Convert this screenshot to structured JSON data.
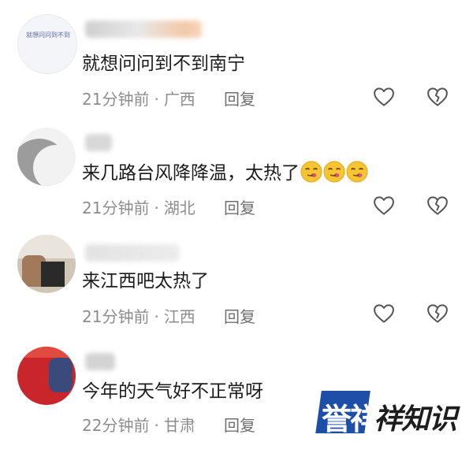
{
  "comments": [
    {
      "text": "就想问问到不到南宁",
      "time": "21分钟前",
      "location": "广西",
      "reply_label": "回复",
      "avatar_text": "就想问问到不到"
    },
    {
      "text": "来几路台风降降温，太热了",
      "time": "21分钟前",
      "location": "湖北",
      "reply_label": "回复"
    },
    {
      "text": "来江西吧太热了",
      "time": "21分钟前",
      "location": "江西",
      "reply_label": "回复"
    },
    {
      "text": "今年的天气好不正常呀",
      "time": "22分钟前",
      "location": "甘肃",
      "reply_label": "回复"
    }
  ],
  "separator": "·",
  "watermark": {
    "box_text": "誉祥",
    "text": "祥知识"
  },
  "icons": {
    "like": "heart-outline-icon",
    "dislike": "broken-heart-icon",
    "emoji": "smirk-emoji-icon"
  },
  "colors": {
    "text": "#1c1c1c",
    "meta": "#8d8d8d",
    "logo_blue": "#1e4fa8"
  }
}
